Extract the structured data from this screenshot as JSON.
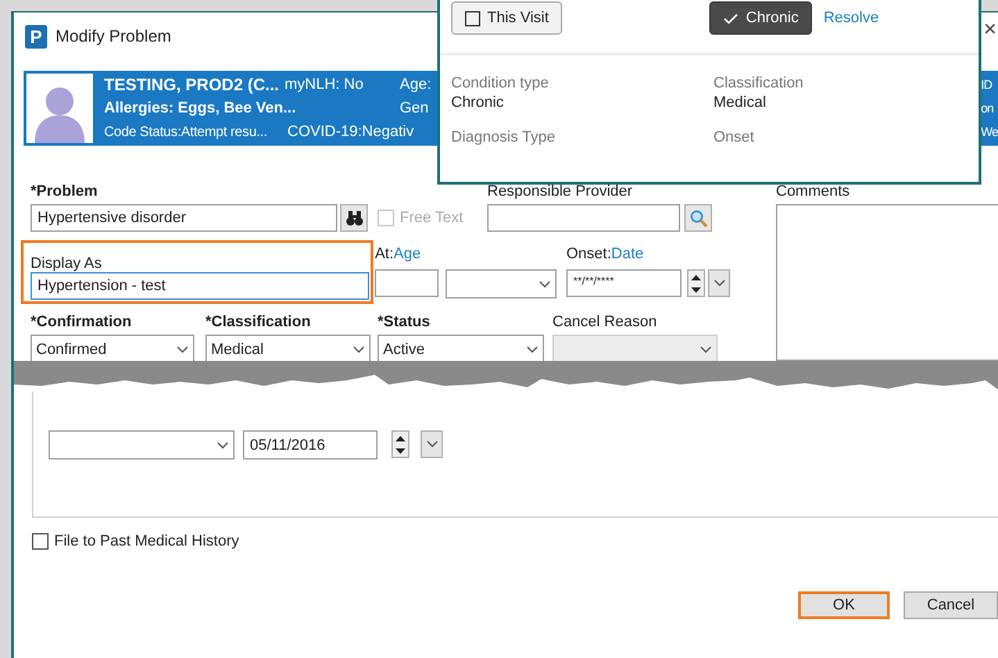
{
  "window": {
    "app_icon": "P",
    "title": "Modify Problem",
    "close": "×"
  },
  "patient_banner": {
    "name": "TESTING, PROD2 (C...",
    "allergies": "Allergies: Eggs, Bee Ven...",
    "code_status": "Code Status:Attempt resu...",
    "mynlh": "myNLH: No",
    "covid": "COVID-19:Negativ",
    "age": "Age:",
    "gender": "Gen",
    "right_column": [
      "ID",
      "on",
      "We"
    ]
  },
  "popup": {
    "buttons": [
      {
        "label": "This Visit",
        "kind": "checkbox",
        "selected": false
      },
      {
        "label": "Chronic",
        "kind": "check",
        "selected": true
      }
    ],
    "link": "Resolve",
    "details": [
      {
        "label": "Condition type",
        "value": "Chronic"
      },
      {
        "label": "Classification",
        "value": "Medical"
      },
      {
        "label": "Diagnosis Type"
      },
      {
        "label": "Onset"
      }
    ]
  },
  "form": {
    "problem": {
      "label": "*Problem",
      "value": "Hypertensive disorder"
    },
    "free_text": {
      "label": "Free Text",
      "checked": false,
      "disabled": true
    },
    "responsible_provider": {
      "label": "Responsible Provider"
    },
    "comments": {
      "label": "Comments"
    },
    "display_as": {
      "label": "Display As",
      "value": "Hypertension - test"
    },
    "onset_age": {
      "label": "At:",
      "link": "Age"
    },
    "onset_date": {
      "label": "Onset:",
      "link": "Date",
      "value": "**/**/****"
    },
    "confirmation": {
      "label": "*Confirmation",
      "value": "Confirmed"
    },
    "classification": {
      "label": "*Classification",
      "value": "Medical"
    },
    "status": {
      "label": "*Status",
      "value": "Active"
    },
    "cancel_reason": {
      "label": "Cancel Reason",
      "disabled": true
    },
    "lower_date": {
      "value": "05/11/2016"
    },
    "file_to_pmh": {
      "label": "File to Past Medical History",
      "checked": false
    }
  },
  "buttons": [
    {
      "label": "OK",
      "focused": true
    },
    {
      "label": "Cancel",
      "focused": false
    }
  ]
}
